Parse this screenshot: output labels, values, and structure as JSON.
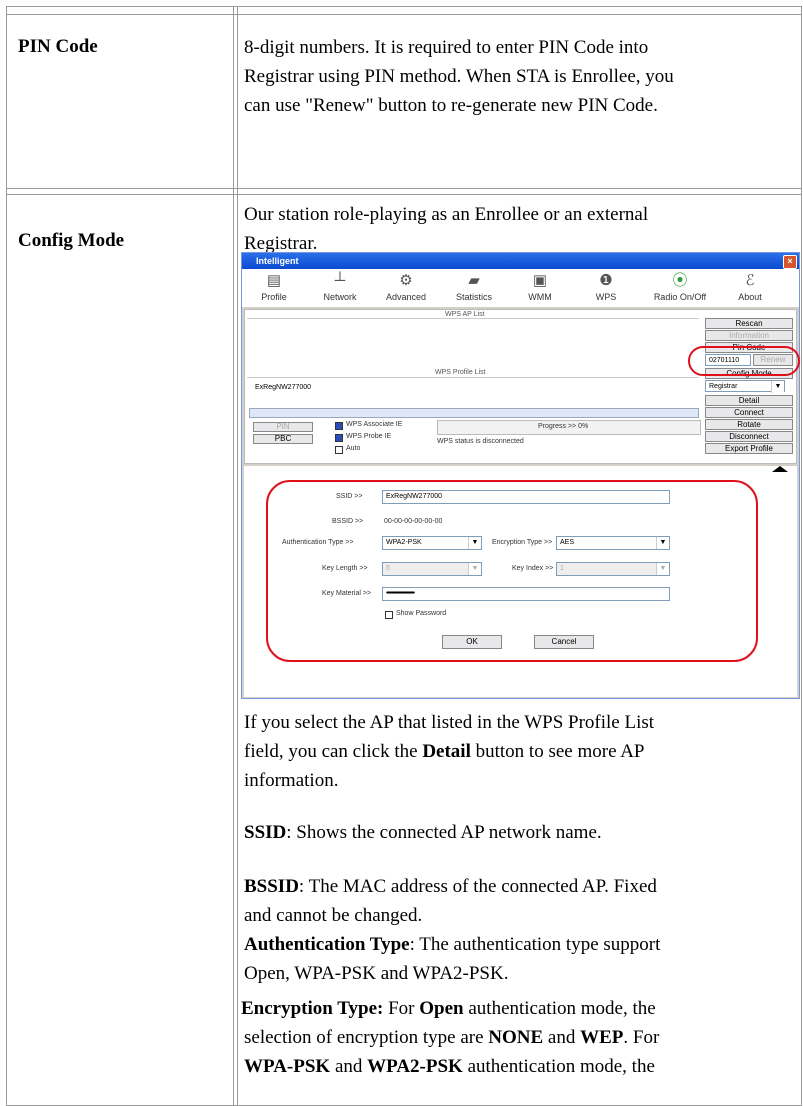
{
  "rows": [
    {
      "label": "PIN Code",
      "lines": [
        "8-digit numbers. It is required to enter PIN Code into",
        "Registrar using PIN method. When STA is Enrollee, you",
        "can use \"Renew\" button to re-generate new PIN Code."
      ]
    },
    {
      "label": "Config Mode",
      "intro_lines": [
        "Our station role-playing as an Enrollee or an external",
        "Registrar."
      ]
    }
  ],
  "screenshot": {
    "title": "Intelligent",
    "close": "×",
    "toolbar": [
      "Profile",
      "Network",
      "Advanced",
      "Statistics",
      "WMM",
      "WPS",
      "Radio On/Off",
      "About"
    ],
    "wps_ap_list": "WPS AP List",
    "wps_profile_list": "WPS Profile List",
    "profile_entry": "ExRegNW277000",
    "buttons": {
      "rescan": "Rescan",
      "information": "Information",
      "pin_code_label": "Pin Code",
      "pin_value": "02701110",
      "renew": "Renew",
      "config_mode_label": "Config Mode",
      "config_mode_value": "Registrar",
      "detail": "Detail",
      "connect": "Connect",
      "rotate": "Rotate",
      "disconnect": "Disconnect",
      "export_profile": "Export Profile",
      "pin": "PIN",
      "pbc": "PBC"
    },
    "checks": {
      "assoc": "WPS Associate IE",
      "probe": "WPS Probe IE",
      "auto": "Auto"
    },
    "progress": "Progress >> 0%",
    "status": "WPS status is disconnected",
    "detail": {
      "ssid_label": "SSID >>",
      "ssid_value": "ExRegNW277000",
      "bssid_label": "BSSID >>",
      "bssid_value": "00-00-00-00-00-00",
      "auth_label": "Authentication Type >>",
      "auth_value": "WPA2-PSK",
      "enc_label": "Encryption Type >>",
      "enc_value": "AES",
      "keylen_label": "Key Length >>",
      "keylen_value": "5",
      "keyidx_label": "Key Index >>",
      "keyidx_value": "1",
      "keymat_label": "Key Material >>",
      "keymat_value": "••••••••••••••••••••••••••••••••••••••••••••••••••••••••••••",
      "show_password": "Show Password",
      "ok": "OK",
      "cancel": "Cancel"
    }
  },
  "body": {
    "p1_lines": [
      "If you select the AP that listed in the WPS Profile List",
      "field, you can click the ",
      "Detail",
      " button to see more AP",
      "information."
    ],
    "ssid_term": "SSID",
    "ssid_desc": ": Shows the connected AP network name.",
    "bssid_term": "BSSID",
    "bssid_desc1": ": The MAC address of the connected AP. Fixed",
    "bssid_desc2": "and cannot be changed.",
    "auth_term": "Authentication Type",
    "auth_desc1": ": The authentication type support",
    "auth_desc2": "Open, WPA-PSK and WPA2-PSK.",
    "enc_term": "Encryption Type:",
    "enc_l1a": " For ",
    "enc_l1b": "Open",
    "enc_l1c": " authentication mode, the",
    "enc_l2a": "selection of encryption type are ",
    "enc_l2b": "NONE",
    "enc_l2c": " and ",
    "enc_l2d": "WEP",
    "enc_l2e": ". For",
    "enc_l3a": "WPA-PSK",
    "enc_l3b": " and ",
    "enc_l3c": "WPA2-PSK",
    "enc_l3d": " authentication mode, the"
  }
}
